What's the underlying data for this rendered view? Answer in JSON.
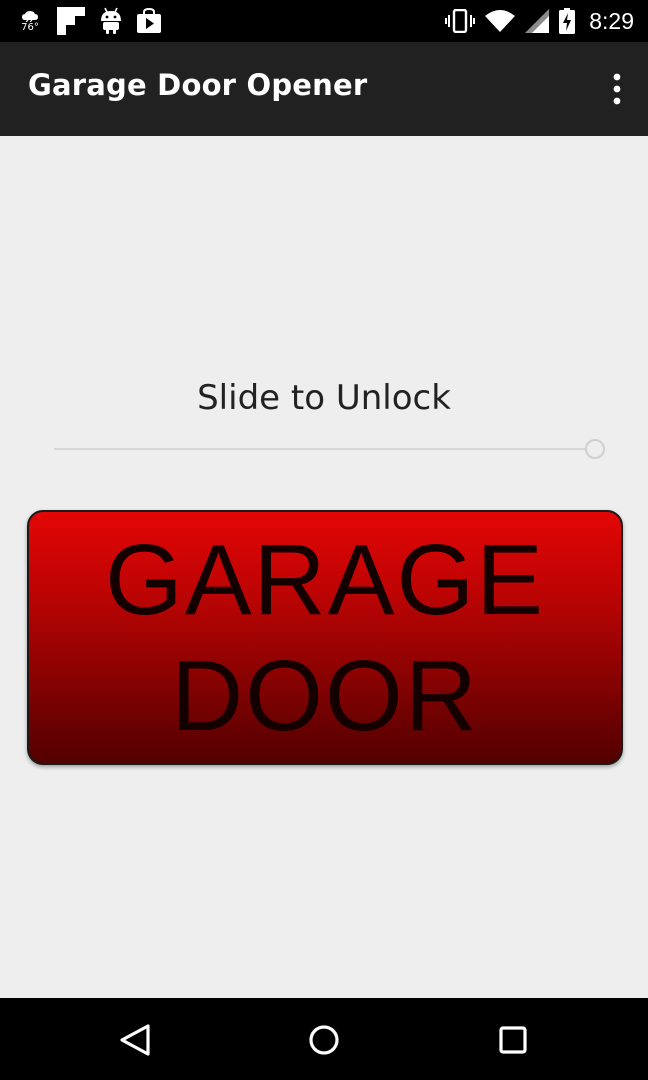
{
  "status_bar": {
    "weather_temp": "76°",
    "time": "8:29",
    "left_icons": [
      "weather-icon",
      "flipboard-icon",
      "android-icon",
      "play-store-icon"
    ],
    "right_icons": [
      "vibrate-icon",
      "wifi-icon",
      "signal-icon",
      "battery-charging-icon"
    ]
  },
  "action_bar": {
    "title": "Garage Door Opener",
    "overflow_icon": "more-vert-icon"
  },
  "main": {
    "slide_label": "Slide to Unlock",
    "slider_value": 1.0,
    "button_line1": "GARAGE",
    "button_line2": "DOOR",
    "button_colors": [
      "#e30606",
      "#520000"
    ]
  },
  "nav_bar": {
    "icons": [
      "back-icon",
      "home-icon",
      "recents-icon"
    ]
  }
}
